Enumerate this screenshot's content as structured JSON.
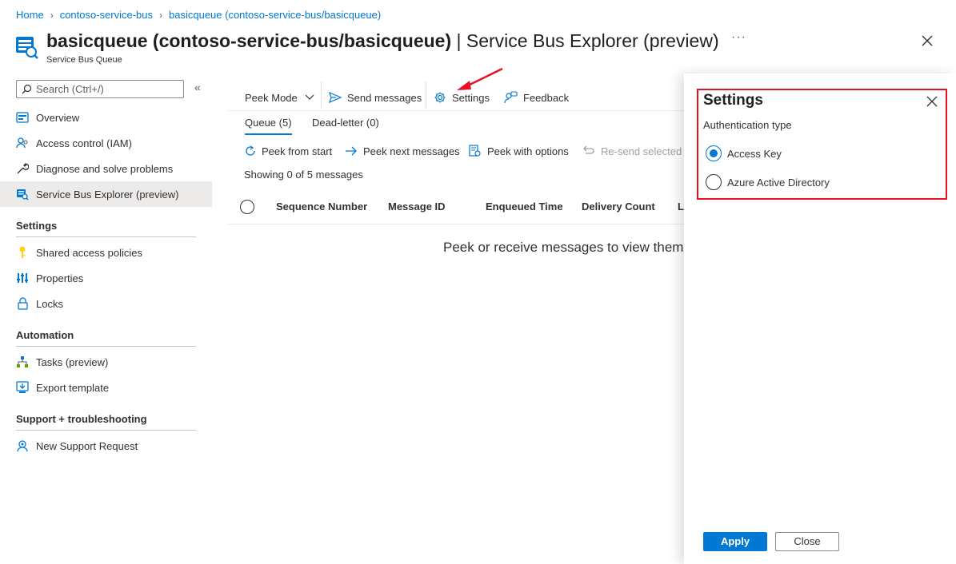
{
  "breadcrumb": [
    "Home",
    "contoso-service-bus",
    "basicqueue (contoso-service-bus/basicqueue)"
  ],
  "header": {
    "title_bold": "basicqueue (contoso-service-bus/basicqueue)",
    "title_rest": " | Service Bus Explorer (preview)",
    "subtitle": "Service Bus Queue",
    "more": "···"
  },
  "sidebar": {
    "search_placeholder": "Search (Ctrl+/)",
    "collapse": "«",
    "items": [
      {
        "label": "Overview",
        "icon": "overview-icon"
      },
      {
        "label": "Access control (IAM)",
        "icon": "people-icon"
      },
      {
        "label": "Diagnose and solve problems",
        "icon": "wrench-icon"
      },
      {
        "label": "Service Bus Explorer (preview)",
        "icon": "explorer-icon"
      }
    ],
    "sections": [
      {
        "title": "Settings",
        "items": [
          {
            "label": "Shared access policies",
            "icon": "key-icon"
          },
          {
            "label": "Properties",
            "icon": "properties-icon"
          },
          {
            "label": "Locks",
            "icon": "lock-icon"
          }
        ]
      },
      {
        "title": "Automation",
        "items": [
          {
            "label": "Tasks (preview)",
            "icon": "tasks-icon"
          },
          {
            "label": "Export template",
            "icon": "export-icon"
          }
        ]
      },
      {
        "title": "Support + troubleshooting",
        "items": [
          {
            "label": "New Support Request",
            "icon": "support-icon"
          }
        ]
      }
    ]
  },
  "toolbar": {
    "peek_mode": "Peek Mode",
    "send_messages": "Send messages",
    "settings": "Settings",
    "feedback": "Feedback"
  },
  "tabs": [
    "Queue (5)",
    "Dead-letter (0)"
  ],
  "commands": {
    "peek_from_start": "Peek from start",
    "peek_next": "Peek next messages",
    "peek_options": "Peek with options",
    "resend": "Re-send selected m"
  },
  "showing": "Showing 0 of 5 messages",
  "table": {
    "columns": [
      "Sequence Number",
      "Message ID",
      "Enqueued Time",
      "Delivery Count",
      "La"
    ],
    "empty_message": "Peek or receive messages to view them"
  },
  "settings_panel": {
    "title": "Settings",
    "auth_label": "Authentication type",
    "options": [
      "Access Key",
      "Azure Active Directory"
    ],
    "selected": "Access Key",
    "apply": "Apply",
    "close": "Close"
  },
  "colors": {
    "accent": "#0078d4",
    "highlight": "#e81123"
  }
}
